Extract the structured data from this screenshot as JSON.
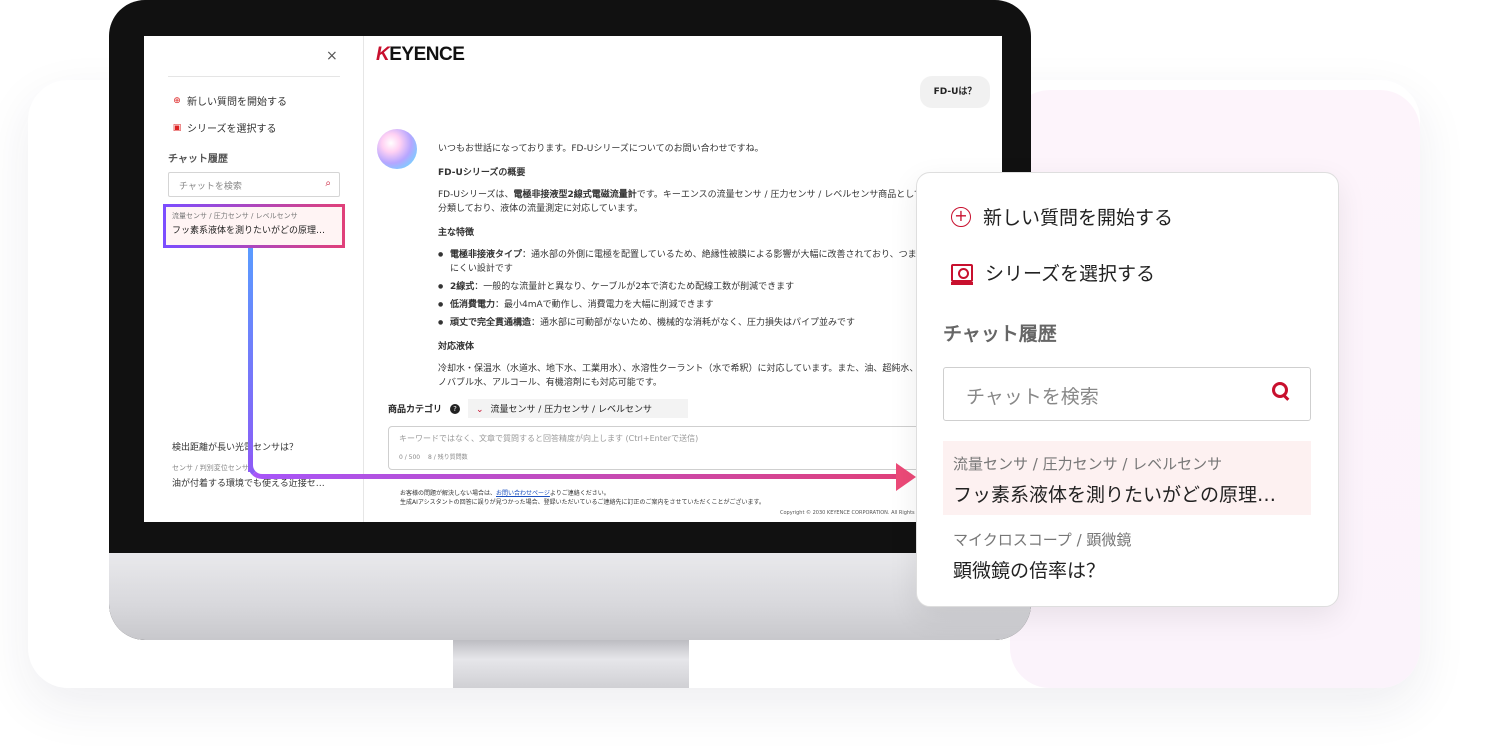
{
  "sidebar": {
    "close_label": "×",
    "new_question": "新しい質問を開始する",
    "select_series": "シリーズを選択する",
    "history_heading": "チャット履歴",
    "search_placeholder": "チャットを検索",
    "history": [
      {
        "category": "流量センサ / 圧力センサ / レベルセンサ",
        "question": "フッ素系液体を測りたいがどの原理…"
      },
      {
        "category": "",
        "question": "検出距離が長い光電センサは？"
      },
      {
        "category": "センサ / 判別変位センサ",
        "question": "油が付着する環境でも使える近接セ…"
      }
    ]
  },
  "header": {
    "logo": "KEYENCE",
    "logo_k": "K",
    "logo_rest": "EYENCE"
  },
  "chat": {
    "user_message": "FD-Uは？",
    "answer": {
      "intro": "いつもお世話になっております。FD-Uシリーズについてのお問い合わせですね。",
      "overview_heading": "FD-Uシリーズの概要",
      "overview_pre": "FD-Uシリーズは、",
      "overview_bold": "電極非接液型2線式電磁流量計",
      "overview_post": "です。キーエンスの流量センサ / 圧力センサ / レベルセンサ商品として分類しており、液体の流量測定に対応しています。",
      "features_heading": "主な特徴",
      "features": [
        {
          "title": "電極非接液タイプ",
          "text": "：通水部の外側に電極を配置しているため、絶縁性被膜による影響が大幅に改善されており、つまりにくい設計です"
        },
        {
          "title": "2線式",
          "text": "：一般的な流量計と異なり、ケーブルが2本で済むため配線工数が削減できます"
        },
        {
          "title": "低消費電力",
          "text": "：最小4mAで動作し、消費電力を大幅に削減できます"
        },
        {
          "title": "頑丈で完全貫通構造",
          "text": "：通水部に可動部がないため、機械的な消耗がなく、圧力損失はパイプ並みです"
        }
      ],
      "liquids_heading": "対応液体",
      "liquids_text": "冷却水・保温水（水道水、地下水、工業用水）、水溶性クーラント（水で希釈）に対応しています。また、油、超純水、ナノバブル水、アルコール、有機溶剤にも対応可能です。"
    }
  },
  "composer": {
    "category_label": "商品カテゴリ",
    "help_icon": "?",
    "category_value": "流量センサ / 圧力センサ / レベルセンサ",
    "placeholder": "キーワードではなく、文章で質問すると回答精度が向上します (Ctrl+Enterで送信)",
    "count": "0 / 500　 8 / 残り質問数",
    "footer_pre": "お客様の問題が解決しない場合は、",
    "footer_link": "お問い合わせページ",
    "footer_post": "よりご連絡ください。",
    "footer_note": "生成AIアシスタントの回答に誤りが見つかった場合、登録いただいているご連絡先に訂正のご案内をさせていただくことがございます。",
    "copyright": "Copyright © 2030 KEYENCE CORPORATION. All Rights Reserved."
  },
  "zoom": {
    "new_question": "新しい質問を開始する",
    "select_series": "シリーズを選択する",
    "history_heading": "チャット履歴",
    "search_placeholder": "チャットを検索",
    "history": [
      {
        "category": "流量センサ / 圧力センサ / レベルセンサ",
        "question": "フッ素系液体を測りたいがどの原理…"
      },
      {
        "category": "マイクロスコープ / 顕微鏡",
        "question": "顕微鏡の倍率は？"
      }
    ]
  },
  "colors": {
    "accent": "#c8102e",
    "gradient_start": "#5a9bff",
    "gradient_end": "#ec4a78"
  },
  "icons": [
    "close-icon",
    "plus-circle-icon",
    "series-icon",
    "search-icon",
    "chevron-down-icon",
    "help-icon"
  ]
}
